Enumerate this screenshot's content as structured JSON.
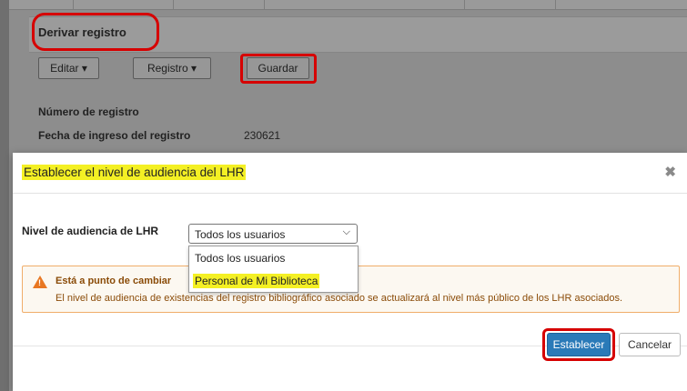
{
  "background": {
    "section_title": "Derivar registro",
    "toolbar": {
      "edit_label": "Editar ▾",
      "record_label": "Registro ▾",
      "save_label": "Guardar"
    },
    "fields": [
      {
        "label": "Número de registro",
        "value": ""
      },
      {
        "label": "Fecha de ingreso del registro",
        "value": "230621"
      }
    ]
  },
  "modal": {
    "title": "Establecer el nivel de audiencia del LHR",
    "close_icon": "close-icon",
    "field_label": "Nivel de audiencia de LHR",
    "select": {
      "selected": "Todos los usuarios",
      "options": [
        "Todos los usuarios",
        "Personal de Mi Biblioteca"
      ]
    },
    "warning": {
      "icon": "warning-icon",
      "title": "Está a punto de cambiar",
      "text": "El nivel de audiencia de existencias del registro bibliográfico asociado se actualizará al nivel más público de los LHR asociados."
    },
    "buttons": {
      "confirm": "Establecer",
      "cancel": "Cancelar"
    }
  },
  "colors": {
    "highlight_yellow": "#f4f024",
    "annotation_red": "#d60000",
    "primary_blue": "#2a7ab8",
    "warning_orange": "#e87722"
  }
}
